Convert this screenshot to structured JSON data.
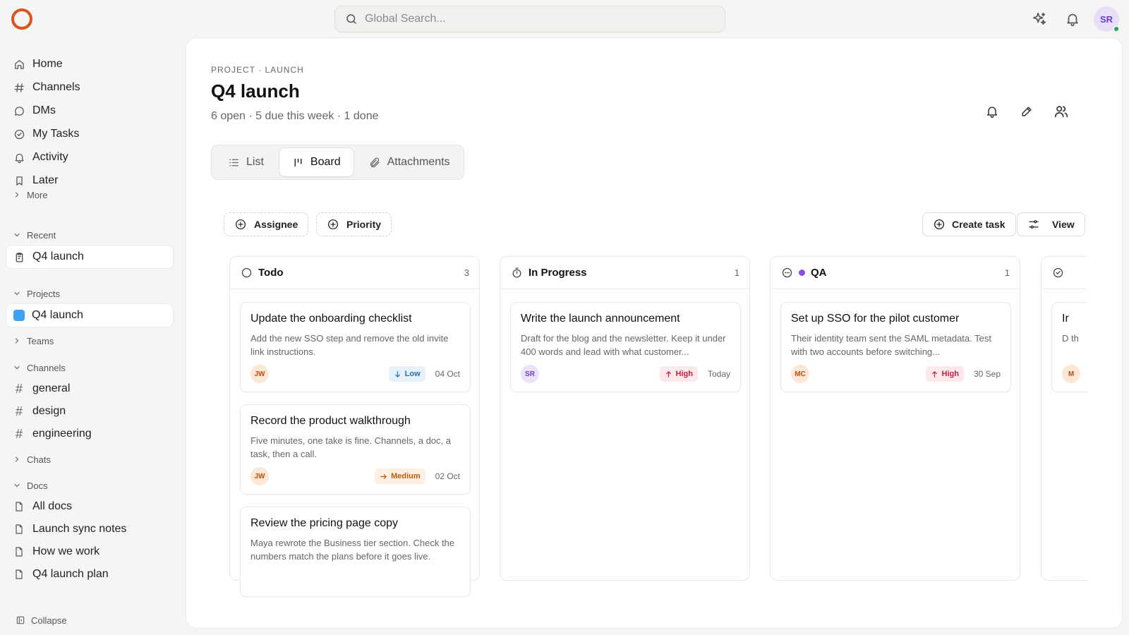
{
  "search": {
    "placeholder": "Global Search..."
  },
  "user": {
    "initials": "SR"
  },
  "sidebar": {
    "nav": [
      {
        "label": "Home",
        "icon": "home-icon"
      },
      {
        "label": "Channels",
        "icon": "hash-icon"
      },
      {
        "label": "DMs",
        "icon": "chat-icon"
      },
      {
        "label": "My Tasks",
        "icon": "check-circle-icon"
      },
      {
        "label": "Activity",
        "icon": "bell-icon"
      },
      {
        "label": "Later",
        "icon": "bookmark-icon"
      }
    ],
    "more": "More",
    "recent_label": "Recent",
    "recent_item": "Q4 launch",
    "projects_label": "Projects",
    "project_item": "Q4 launch",
    "teams_label": "Teams",
    "channels_label": "Channels",
    "channels": [
      "general",
      "design",
      "engineering"
    ],
    "chats_label": "Chats",
    "docs_label": "Docs",
    "docs": [
      "All docs",
      "Launch sync notes",
      "How we work",
      "Q4 launch plan"
    ],
    "collapse": "Collapse"
  },
  "main": {
    "breadcrumb": "PROJECT · LAUNCH",
    "title": "Q4 launch",
    "subtitle": "6 open · 5 due this week · 1 done",
    "tabs": [
      {
        "label": "List"
      },
      {
        "label": "Board"
      },
      {
        "label": "Attachments"
      }
    ],
    "filters": {
      "assignee": "Assignee",
      "priority": "Priority"
    },
    "actions": {
      "create": "Create task",
      "view": "View"
    }
  },
  "board": {
    "columns": [
      {
        "name": "Todo",
        "count": "3",
        "cards": [
          {
            "title": "Update the onboarding checklist",
            "desc": "Add the new SSO step and remove the old invite link instructions.",
            "assignee": "JW",
            "priority": "Low",
            "due": "04 Oct"
          },
          {
            "title": "Record the product walkthrough",
            "desc": "Five minutes, one take is fine. Channels, a doc, a task, then a call.",
            "assignee": "JW",
            "priority": "Medium",
            "due": "02 Oct"
          },
          {
            "title": "Review the pricing page copy",
            "desc": "Maya rewrote the Business tier section. Check the numbers match the plans before it goes live.",
            "assignee": "",
            "priority": "",
            "due": ""
          }
        ]
      },
      {
        "name": "In Progress",
        "count": "1",
        "cards": [
          {
            "title": "Write the launch announcement",
            "desc": "Draft for the blog and the newsletter. Keep it under 400 words and lead with what customer...",
            "assignee": "SR",
            "priority": "High",
            "due": "Today"
          }
        ]
      },
      {
        "name": "QA",
        "count": "1",
        "cards": [
          {
            "title": "Set up SSO for the pilot customer",
            "desc": "Their identity team sent the SAML metadata. Test with two accounts before switching...",
            "assignee": "MC",
            "priority": "High",
            "due": "30 Sep"
          }
        ]
      },
      {
        "name": "",
        "count": "",
        "cards": [
          {
            "title": "Ir",
            "desc": "D th",
            "assignee": "M",
            "priority": "",
            "due": ""
          }
        ]
      }
    ]
  },
  "colors": {
    "accent_logo": "#d9541e",
    "project_swatch": "#3aa3f5",
    "qa_dot": "#8a4de8",
    "priority_low_bg": "#e6f1fb",
    "priority_low_fg": "#1f6fb8",
    "priority_medium_bg": "#fdf0e2",
    "priority_medium_fg": "#c05a10",
    "priority_high_bg": "#fde8ec",
    "priority_high_fg": "#c8203f"
  }
}
